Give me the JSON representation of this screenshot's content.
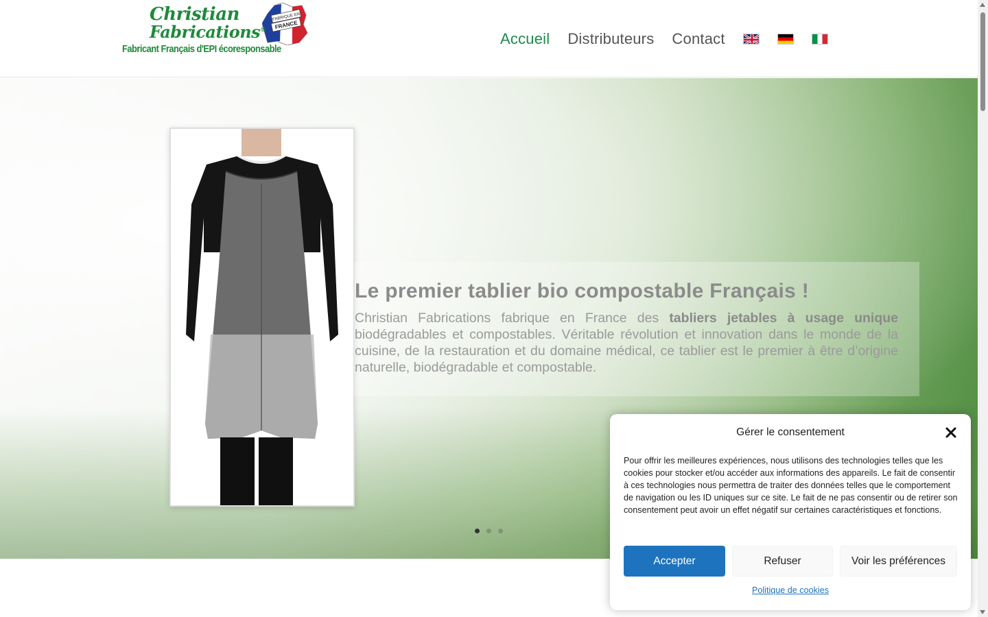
{
  "header": {
    "logo": {
      "name_line1": "Christian",
      "name_line2": "Fabrications",
      "reg_mark": "®",
      "tagline": "Fabricant Français d'EPI écoresponsable",
      "badge_top": "FABRIQUE EN",
      "badge_bottom": "FRANCE"
    },
    "nav": [
      {
        "label": "Accueil",
        "active": true
      },
      {
        "label": "Distributeurs",
        "active": false
      },
      {
        "label": "Contact",
        "active": false
      }
    ],
    "flags": [
      {
        "lang": "en",
        "icon": "flag-uk-icon"
      },
      {
        "lang": "de",
        "icon": "flag-germany-icon"
      },
      {
        "lang": "it",
        "icon": "flag-italy-icon"
      }
    ]
  },
  "hero": {
    "title": "Le premier tablier bio compostable Français !",
    "text_before_bold": "Christian Fabrications fabrique en France des ",
    "text_bold": "tabliers jetables à usage unique",
    "text_after_bold": " biodégradables et compostables. Véritable révolution et innovation dans le monde de la cuisine, de la restauration et du domaine médical, ce tablier est le premier à être d’origine naturelle, biodégradable et compostable.",
    "slides": 3,
    "active_slide": 1
  },
  "consent": {
    "title": "Gérer le consentement",
    "body": "Pour offrir les meilleures expériences, nous utilisons des technologies telles que les cookies pour stocker et/ou accéder aux informations des appareils. Le fait de consentir à ces technologies nous permettra de traiter des données telles que le comportement de navigation ou les ID uniques sur ce site. Le fait de ne pas consentir ou de retirer son consentement peut avoir un effet négatif sur certaines caractéristiques et fonctions.",
    "accept_label": "Accepter",
    "refuse_label": "Refuser",
    "prefs_label": "Voir les préférences",
    "policy_label": "Politique de cookies"
  },
  "colors": {
    "brand_green": "#1e8a3a",
    "nav_active": "#1e8a4c",
    "accept_blue": "#1e73be"
  }
}
